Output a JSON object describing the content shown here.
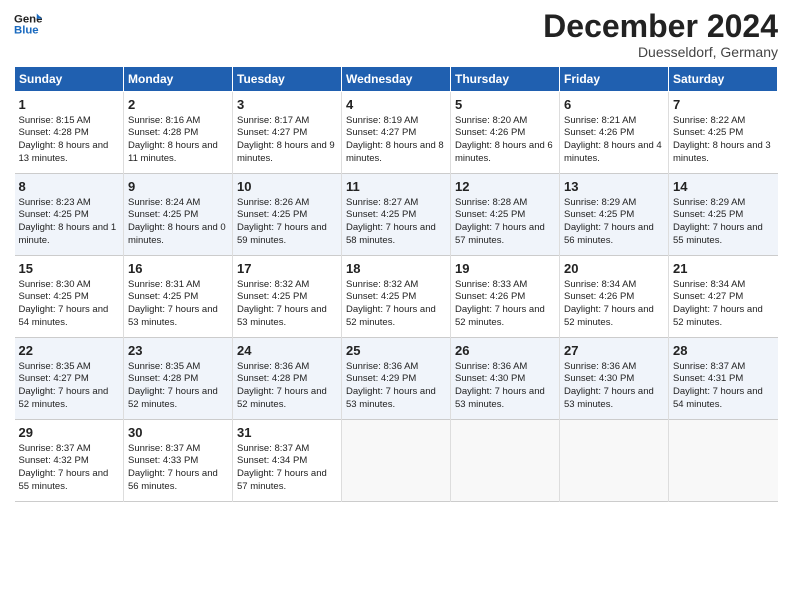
{
  "header": {
    "logo_line1": "General",
    "logo_line2": "Blue",
    "month": "December 2024",
    "location": "Duesseldorf, Germany"
  },
  "weekdays": [
    "Sunday",
    "Monday",
    "Tuesday",
    "Wednesday",
    "Thursday",
    "Friday",
    "Saturday"
  ],
  "weeks": [
    [
      {
        "day": 1,
        "sunrise": "8:15 AM",
        "sunset": "4:28 PM",
        "daylight": "8 hours and 13 minutes."
      },
      {
        "day": 2,
        "sunrise": "8:16 AM",
        "sunset": "4:28 PM",
        "daylight": "8 hours and 11 minutes."
      },
      {
        "day": 3,
        "sunrise": "8:17 AM",
        "sunset": "4:27 PM",
        "daylight": "8 hours and 9 minutes."
      },
      {
        "day": 4,
        "sunrise": "8:19 AM",
        "sunset": "4:27 PM",
        "daylight": "8 hours and 8 minutes."
      },
      {
        "day": 5,
        "sunrise": "8:20 AM",
        "sunset": "4:26 PM",
        "daylight": "8 hours and 6 minutes."
      },
      {
        "day": 6,
        "sunrise": "8:21 AM",
        "sunset": "4:26 PM",
        "daylight": "8 hours and 4 minutes."
      },
      {
        "day": 7,
        "sunrise": "8:22 AM",
        "sunset": "4:25 PM",
        "daylight": "8 hours and 3 minutes."
      }
    ],
    [
      {
        "day": 8,
        "sunrise": "8:23 AM",
        "sunset": "4:25 PM",
        "daylight": "8 hours and 1 minute."
      },
      {
        "day": 9,
        "sunrise": "8:24 AM",
        "sunset": "4:25 PM",
        "daylight": "8 hours and 0 minutes."
      },
      {
        "day": 10,
        "sunrise": "8:26 AM",
        "sunset": "4:25 PM",
        "daylight": "7 hours and 59 minutes."
      },
      {
        "day": 11,
        "sunrise": "8:27 AM",
        "sunset": "4:25 PM",
        "daylight": "7 hours and 58 minutes."
      },
      {
        "day": 12,
        "sunrise": "8:28 AM",
        "sunset": "4:25 PM",
        "daylight": "7 hours and 57 minutes."
      },
      {
        "day": 13,
        "sunrise": "8:29 AM",
        "sunset": "4:25 PM",
        "daylight": "7 hours and 56 minutes."
      },
      {
        "day": 14,
        "sunrise": "8:29 AM",
        "sunset": "4:25 PM",
        "daylight": "7 hours and 55 minutes."
      }
    ],
    [
      {
        "day": 15,
        "sunrise": "8:30 AM",
        "sunset": "4:25 PM",
        "daylight": "7 hours and 54 minutes."
      },
      {
        "day": 16,
        "sunrise": "8:31 AM",
        "sunset": "4:25 PM",
        "daylight": "7 hours and 53 minutes."
      },
      {
        "day": 17,
        "sunrise": "8:32 AM",
        "sunset": "4:25 PM",
        "daylight": "7 hours and 53 minutes."
      },
      {
        "day": 18,
        "sunrise": "8:32 AM",
        "sunset": "4:25 PM",
        "daylight": "7 hours and 52 minutes."
      },
      {
        "day": 19,
        "sunrise": "8:33 AM",
        "sunset": "4:26 PM",
        "daylight": "7 hours and 52 minutes."
      },
      {
        "day": 20,
        "sunrise": "8:34 AM",
        "sunset": "4:26 PM",
        "daylight": "7 hours and 52 minutes."
      },
      {
        "day": 21,
        "sunrise": "8:34 AM",
        "sunset": "4:27 PM",
        "daylight": "7 hours and 52 minutes."
      }
    ],
    [
      {
        "day": 22,
        "sunrise": "8:35 AM",
        "sunset": "4:27 PM",
        "daylight": "7 hours and 52 minutes."
      },
      {
        "day": 23,
        "sunrise": "8:35 AM",
        "sunset": "4:28 PM",
        "daylight": "7 hours and 52 minutes."
      },
      {
        "day": 24,
        "sunrise": "8:36 AM",
        "sunset": "4:28 PM",
        "daylight": "7 hours and 52 minutes."
      },
      {
        "day": 25,
        "sunrise": "8:36 AM",
        "sunset": "4:29 PM",
        "daylight": "7 hours and 53 minutes."
      },
      {
        "day": 26,
        "sunrise": "8:36 AM",
        "sunset": "4:30 PM",
        "daylight": "7 hours and 53 minutes."
      },
      {
        "day": 27,
        "sunrise": "8:36 AM",
        "sunset": "4:30 PM",
        "daylight": "7 hours and 53 minutes."
      },
      {
        "day": 28,
        "sunrise": "8:37 AM",
        "sunset": "4:31 PM",
        "daylight": "7 hours and 54 minutes."
      }
    ],
    [
      {
        "day": 29,
        "sunrise": "8:37 AM",
        "sunset": "4:32 PM",
        "daylight": "7 hours and 55 minutes."
      },
      {
        "day": 30,
        "sunrise": "8:37 AM",
        "sunset": "4:33 PM",
        "daylight": "7 hours and 56 minutes."
      },
      {
        "day": 31,
        "sunrise": "8:37 AM",
        "sunset": "4:34 PM",
        "daylight": "7 hours and 57 minutes."
      },
      null,
      null,
      null,
      null
    ]
  ]
}
